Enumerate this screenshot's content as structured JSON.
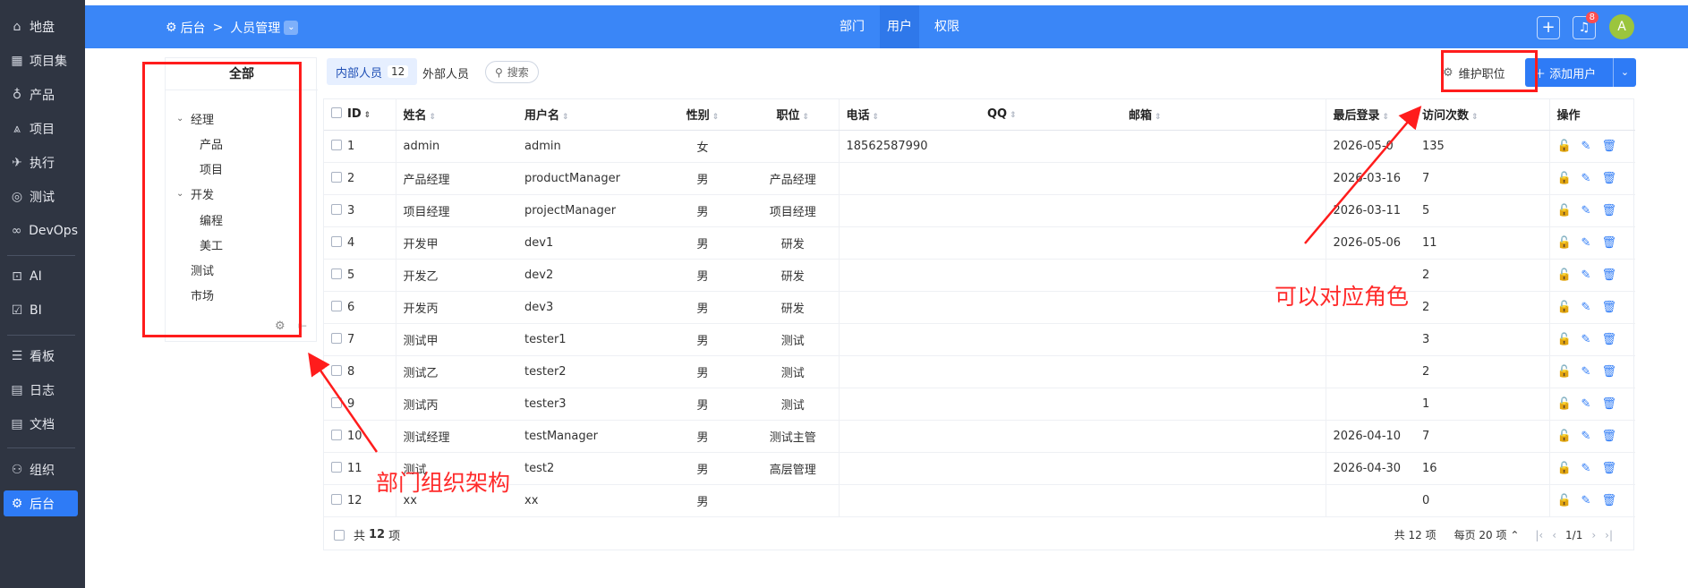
{
  "sidebar": {
    "items": [
      {
        "label": "地盘",
        "icon": "home-icon",
        "glyph": "⌂"
      },
      {
        "label": "项目集",
        "icon": "grid-icon",
        "glyph": "▦"
      },
      {
        "label": "产品",
        "icon": "lightbulb-icon",
        "glyph": "♁"
      },
      {
        "label": "项目",
        "icon": "rocket-icon",
        "glyph": "⩓"
      },
      {
        "label": "执行",
        "icon": "run-icon",
        "glyph": "✈"
      },
      {
        "label": "测试",
        "icon": "bug-icon",
        "glyph": "◎"
      },
      {
        "label": "DevOps",
        "icon": "infinity-icon",
        "glyph": "∞"
      },
      {
        "label": "AI",
        "icon": "robot-icon",
        "glyph": "⊡"
      },
      {
        "label": "BI",
        "icon": "chart-icon",
        "glyph": "☑"
      },
      {
        "label": "看板",
        "icon": "kanban-icon",
        "glyph": "☰"
      },
      {
        "label": "日志",
        "icon": "log-icon",
        "glyph": "▤"
      },
      {
        "label": "文档",
        "icon": "doc-icon",
        "glyph": "▤"
      },
      {
        "label": "组织",
        "icon": "users-icon",
        "glyph": "⚇"
      },
      {
        "label": "后台",
        "icon": "gear-icon",
        "glyph": "⚙"
      }
    ]
  },
  "header": {
    "breadcrumb_root": "后台",
    "breadcrumb_current": "人员管理",
    "breadcrumb_sep": ">",
    "tabs": [
      "部门",
      "用户",
      "权限"
    ],
    "active_tab": "用户",
    "bell_count": "8",
    "avatar_letter": "A"
  },
  "tree": {
    "all_label": "全部",
    "nodes": [
      {
        "label": "经理",
        "level": 0,
        "expanded": true
      },
      {
        "label": "产品",
        "level": 1
      },
      {
        "label": "项目",
        "level": 1
      },
      {
        "label": "开发",
        "level": 0,
        "expanded": true
      },
      {
        "label": "编程",
        "level": 1
      },
      {
        "label": "美工",
        "level": 1
      },
      {
        "label": "测试",
        "level": 0
      },
      {
        "label": "市场",
        "level": 0
      }
    ]
  },
  "toolbar": {
    "internal_label": "内部人员",
    "internal_count": "12",
    "external_label": "外部人员",
    "search_label": "搜索",
    "positions_label": "维护职位",
    "add_user_label": "添加用户"
  },
  "table": {
    "columns": [
      "ID",
      "姓名",
      "用户名",
      "性别",
      "职位",
      "电话",
      "QQ",
      "邮箱",
      "最后登录",
      "访问次数",
      "操作"
    ],
    "rows": [
      [
        "1",
        "admin",
        "admin",
        "女",
        "",
        "18562587990",
        "",
        "",
        "2026-05-0",
        "135"
      ],
      [
        "2",
        "产品经理",
        "productManager",
        "男",
        "产品经理",
        "",
        "",
        "",
        "2026-03-16",
        "7"
      ],
      [
        "3",
        "项目经理",
        "projectManager",
        "男",
        "项目经理",
        "",
        "",
        "",
        "2026-03-11",
        "5"
      ],
      [
        "4",
        "开发甲",
        "dev1",
        "男",
        "研发",
        "",
        "",
        "",
        "2026-05-06",
        "11"
      ],
      [
        "5",
        "开发乙",
        "dev2",
        "男",
        "研发",
        "",
        "",
        "",
        "",
        "2"
      ],
      [
        "6",
        "开发丙",
        "dev3",
        "男",
        "研发",
        "",
        "",
        "",
        "",
        "2"
      ],
      [
        "7",
        "测试甲",
        "tester1",
        "男",
        "测试",
        "",
        "",
        "",
        "",
        "3"
      ],
      [
        "8",
        "测试乙",
        "tester2",
        "男",
        "测试",
        "",
        "",
        "",
        "",
        "2"
      ],
      [
        "9",
        "测试丙",
        "tester3",
        "男",
        "测试",
        "",
        "",
        "",
        "",
        "1"
      ],
      [
        "10",
        "测试经理",
        "testManager",
        "男",
        "测试主管",
        "",
        "",
        "",
        "2026-04-10",
        "7"
      ],
      [
        "11",
        "测试",
        "test2",
        "男",
        "高层管理",
        "",
        "",
        "",
        "2026-04-30",
        "16"
      ],
      [
        "12",
        "xx",
        "xx",
        "男",
        "",
        "",
        "",
        "",
        "",
        "0"
      ]
    ]
  },
  "footer": {
    "total_prefix": "共",
    "total_count": "12",
    "total_suffix": "项",
    "pager_total": "共 12 项",
    "per_page": "每页 20 项",
    "page": "1/1"
  },
  "annotations": {
    "tree_note": "部门组织架构",
    "role_note": "可以对应角色",
    "color": "#ff1c1c"
  },
  "colors": {
    "header_bg": "#3a86f7",
    "sidebar_bg": "#2f3542",
    "accent": "#2e7bf6"
  }
}
